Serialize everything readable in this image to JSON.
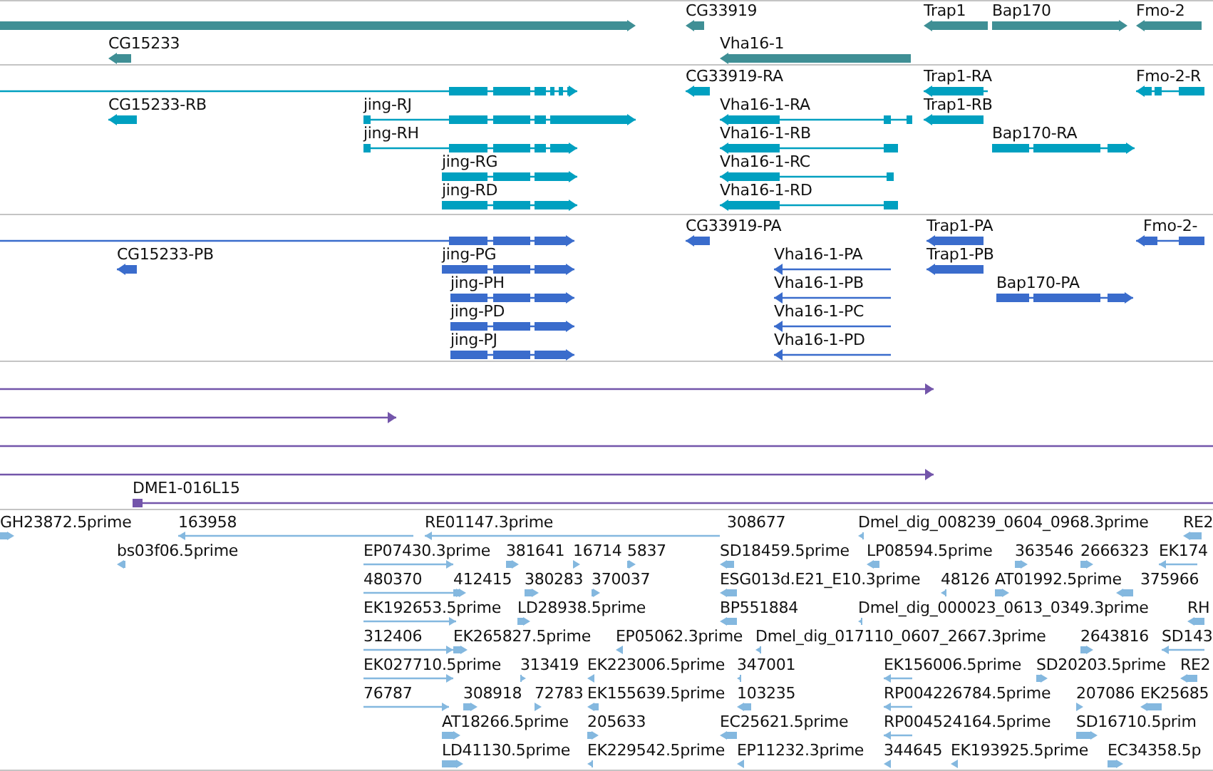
{
  "tracks": [
    {
      "kind": "gene",
      "color": "#3f8f95",
      "features": [
        {
          "reverse": false
        },
        {
          "label": "CG33919",
          "reverse": true
        },
        {
          "label": "Trap1",
          "reverse": true
        },
        {
          "label": "Bap170",
          "reverse": false
        },
        {
          "label": "Fmo-2",
          "reverse": true
        },
        {
          "label": "CG15233",
          "reverse": true
        },
        {
          "label": "Vha16-1",
          "reverse": true
        }
      ]
    },
    {
      "kind": "transcript",
      "color": "#00a0c0",
      "features": [
        {
          "reverse": false
        },
        {
          "label": "CG33919-RA",
          "reverse": true
        },
        {
          "label": "Trap1-RA",
          "reverse": true
        },
        {
          "label": "Fmo-2-R",
          "reverse": true
        },
        {
          "label": "CG15233-RB",
          "reverse": true
        },
        {
          "label": "jing-RJ",
          "reverse": false
        },
        {
          "label": "Vha16-1-RA",
          "reverse": true
        },
        {
          "label": "Trap1-RB",
          "reverse": true
        },
        {
          "label": "jing-RH",
          "reverse": false
        },
        {
          "label": "Vha16-1-RB",
          "reverse": true
        },
        {
          "label": "Bap170-RA",
          "reverse": false
        },
        {
          "label": "jing-RG",
          "reverse": false
        },
        {
          "label": "Vha16-1-RC",
          "reverse": true
        },
        {
          "label": "jing-RD",
          "reverse": false
        },
        {
          "label": "Vha16-1-RD",
          "reverse": true
        }
      ]
    },
    {
      "kind": "protein",
      "color": "#3a6ccc",
      "features": [
        {
          "reverse": false
        },
        {
          "label": "CG33919-PA",
          "reverse": true
        },
        {
          "label": "Trap1-PA",
          "reverse": true
        },
        {
          "label": "Fmo-2-",
          "reverse": true
        },
        {
          "label": "CG15233-PB",
          "reverse": true
        },
        {
          "label": "jing-PG",
          "reverse": false
        },
        {
          "label": "Vha16-1-PA",
          "reverse": true
        },
        {
          "label": "Trap1-PB",
          "reverse": true
        },
        {
          "label": "jing-PH",
          "reverse": false
        },
        {
          "label": "Vha16-1-PB",
          "reverse": true
        },
        {
          "label": "Bap170-PA",
          "reverse": false
        },
        {
          "label": "jing-PD",
          "reverse": false
        },
        {
          "label": "Vha16-1-PC",
          "reverse": true
        },
        {
          "label": "jing-PJ",
          "reverse": false
        },
        {
          "label": "Vha16-1-PD",
          "reverse": true
        }
      ]
    },
    {
      "kind": "clone",
      "color": "#7355aa",
      "features": [
        {
          "reverse": false
        },
        {
          "reverse": false
        },
        {
          "reverse": false
        },
        {
          "reverse": false
        },
        {
          "label": "DME1-016L15",
          "reverse": false
        }
      ]
    },
    {
      "kind": "est",
      "color": "#84b8df",
      "features": [
        {
          "label": "GH23872.5prime",
          "reverse": false
        },
        {
          "label": "163958",
          "reverse": true
        },
        {
          "label": "RE01147.3prime",
          "reverse": true
        },
        {
          "label": "308677"
        },
        {
          "label": "Dmel_dig_008239_0604_0968.3prime",
          "reverse": true
        },
        {
          "label": "RE2",
          "reverse": true
        },
        {
          "label": "bs03f06.5prime",
          "reverse": true
        },
        {
          "label": "EP07430.3prime",
          "reverse": false
        },
        {
          "label": "381641",
          "reverse": false
        },
        {
          "label": "16714",
          "reverse": false
        },
        {
          "label": "5837",
          "reverse": false
        },
        {
          "label": "SD18459.5prime",
          "reverse": true
        },
        {
          "label": "LP08594.5prime",
          "reverse": true
        },
        {
          "label": "363546",
          "reverse": false
        },
        {
          "label": "2666323",
          "reverse": false
        },
        {
          "label": "EK174",
          "reverse": true
        },
        {
          "label": "480370",
          "reverse": false
        },
        {
          "label": "412415",
          "reverse": false
        },
        {
          "label": "380283",
          "reverse": false
        },
        {
          "label": "370037",
          "reverse": false
        },
        {
          "label": "ESG013d.E21_E10.3prime",
          "reverse": true
        },
        {
          "label": "48126",
          "reverse": true
        },
        {
          "label": "AT01992.5prime",
          "reverse": false
        },
        {
          "label": "375966",
          "reverse": true
        },
        {
          "label": "EK192653.5prime",
          "reverse": false
        },
        {
          "label": "LD28938.5prime",
          "reverse": false
        },
        {
          "label": "BP551884",
          "reverse": true
        },
        {
          "label": "Dmel_dig_000023_0613_0349.3prime",
          "reverse": true
        },
        {
          "label": "RH",
          "reverse": true
        },
        {
          "label": "312406",
          "reverse": false
        },
        {
          "label": "EK265827.5prime",
          "reverse": false
        },
        {
          "label": "EP05062.3prime",
          "reverse": true
        },
        {
          "label": "Dmel_dig_017110_0607_2667.3prime",
          "reverse": true
        },
        {
          "label": "2643816",
          "reverse": false
        },
        {
          "label": "SD143",
          "reverse": true
        },
        {
          "label": "EK027710.5prime",
          "reverse": false
        },
        {
          "label": "313419",
          "reverse": false
        },
        {
          "label": "EK223006.5prime",
          "reverse": true
        },
        {
          "label": "347001",
          "reverse": true
        },
        {
          "label": "EK156006.5prime",
          "reverse": true
        },
        {
          "label": "SD20203.5prime",
          "reverse": false
        },
        {
          "label": "RE2",
          "reverse": true
        },
        {
          "label": "76787",
          "reverse": false
        },
        {
          "label": "308918",
          "reverse": false
        },
        {
          "label": "72783",
          "reverse": false
        },
        {
          "label": "EK155639.5prime",
          "reverse": true
        },
        {
          "label": "103235",
          "reverse": true
        },
        {
          "label": "RP004226784.5prime",
          "reverse": true
        },
        {
          "label": "207086",
          "reverse": false
        },
        {
          "label": "EK25685",
          "reverse": true
        },
        {
          "label": "AT18266.5prime",
          "reverse": false
        },
        {
          "label": "205633",
          "reverse": false
        },
        {
          "label": "EC25621.5prime",
          "reverse": true
        },
        {
          "label": "RP004524164.5prime",
          "reverse": true
        },
        {
          "label": "SD16710.5prim",
          "reverse": false
        },
        {
          "label": "LD41130.5prime",
          "reverse": false
        },
        {
          "label": "EK229542.5prime",
          "reverse": true
        },
        {
          "label": "EP11232.3prime",
          "reverse": true
        },
        {
          "label": "344645",
          "reverse": true
        },
        {
          "label": "EK193925.5prime",
          "reverse": true
        },
        {
          "label": "EC34358.5p",
          "reverse": false
        }
      ]
    }
  ]
}
